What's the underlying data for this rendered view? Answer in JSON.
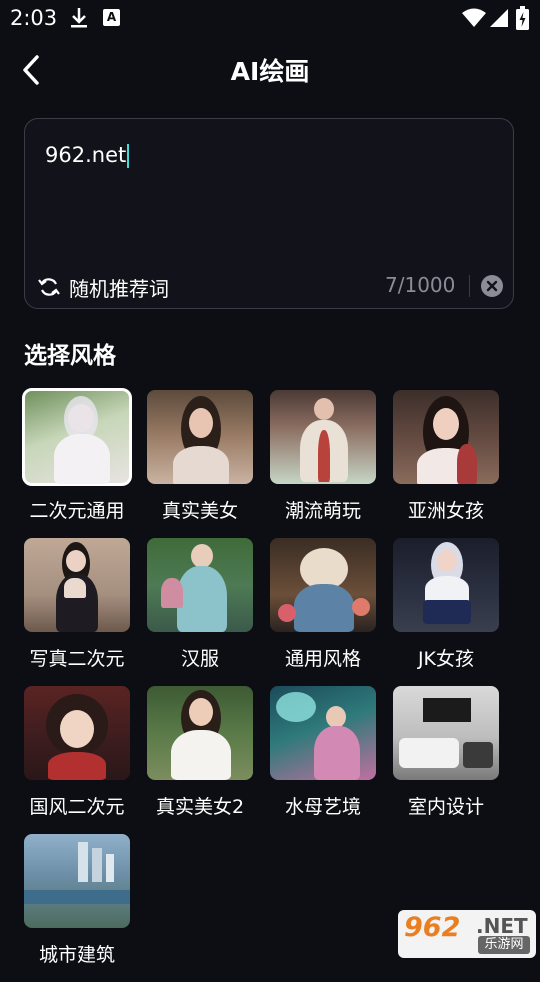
{
  "status_bar": {
    "time": "2:03",
    "badge": "A"
  },
  "header": {
    "title": "AI绘画"
  },
  "prompt": {
    "value": "962.net",
    "random_label": "随机推荐词",
    "counter": "7/1000"
  },
  "styles": {
    "section_title": "选择风格",
    "items": [
      {
        "label": "二次元通用",
        "selected": true
      },
      {
        "label": "真实美女"
      },
      {
        "label": "潮流萌玩"
      },
      {
        "label": "亚洲女孩"
      },
      {
        "label": "写真二次元"
      },
      {
        "label": "汉服"
      },
      {
        "label": "通用风格"
      },
      {
        "label": "JK女孩"
      },
      {
        "label": "国风二次元"
      },
      {
        "label": "真实美女2"
      },
      {
        "label": "水母艺境"
      },
      {
        "label": "室内设计"
      },
      {
        "label": "城市建筑"
      }
    ]
  },
  "watermark": {
    "number": "962",
    "suffix": ".NET",
    "sub": "乐游网"
  },
  "colors": {
    "background": "#0d0e13",
    "caret": "#4ad9d9",
    "muted": "#8b8d96"
  }
}
